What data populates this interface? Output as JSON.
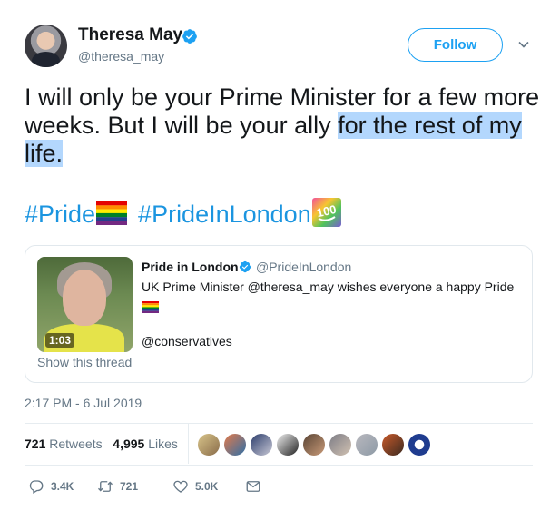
{
  "author": {
    "name": "Theresa May",
    "handle": "@theresa_may",
    "follow_label": "Follow"
  },
  "tweet": {
    "text_plain": "I will only be your Prime Minister for a few more weeks. But I will be your ally ",
    "text_highlighted": "for the rest of my life.",
    "hashtags": [
      "#Pride",
      "#PrideInLondon"
    ]
  },
  "quoted": {
    "name": "Pride in London",
    "handle": "@PrideInLondon",
    "text": "UK Prime Minister @theresa_may wishes everyone a happy Pride",
    "mention": "@conservatives",
    "duration": "1:03",
    "thread_label": "Show this thread"
  },
  "timestamp": "2:17 PM - 6 Jul 2019",
  "stats": {
    "retweets_count": "721",
    "retweets_label": "Retweets",
    "likes_count": "4,995",
    "likes_label": "Likes"
  },
  "actions": {
    "reply_count": "3.4K",
    "retweet_count": "721",
    "like_count": "5.0K"
  },
  "colors": {
    "accent": "#1da1f2",
    "link": "#1b95e0",
    "selection": "#b3d7fd",
    "muted": "#657786"
  },
  "icons": {
    "verified": "verified-badge-icon",
    "caret": "chevron-down-icon",
    "reply": "reply-icon",
    "retweet": "retweet-icon",
    "like": "heart-icon",
    "dm": "envelope-icon"
  }
}
